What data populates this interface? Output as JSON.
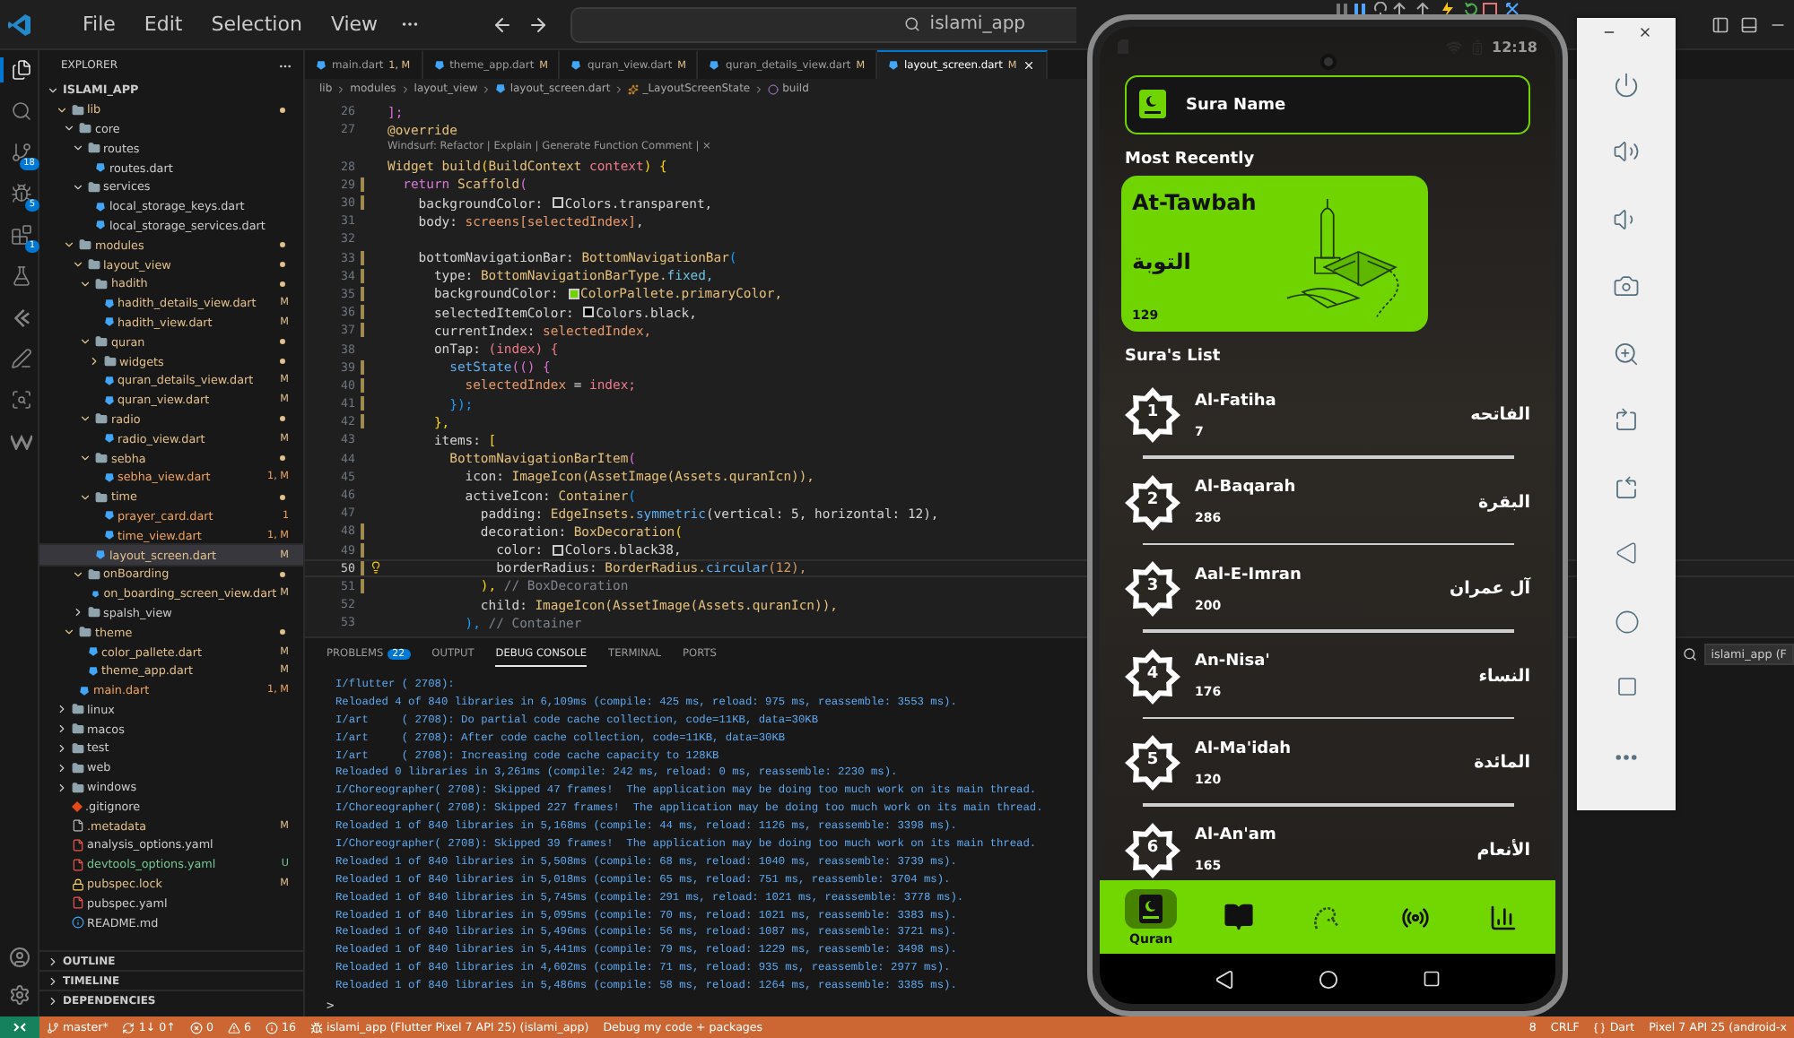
{
  "title_bar": {
    "menu": [
      "File",
      "Edit",
      "Selection",
      "View"
    ],
    "search": {
      "label": "islami_app"
    }
  },
  "activity_bar": [
    {
      "kind": "explorer",
      "selected": true
    },
    {
      "kind": "search",
      "selected": false
    },
    {
      "kind": "source-control",
      "badge": "18",
      "selected": false
    },
    {
      "kind": "debug",
      "badge": "5",
      "selected": false
    },
    {
      "kind": "extensions",
      "badge": "1",
      "selected": false
    },
    {
      "kind": "testing",
      "selected": false
    },
    {
      "kind": "flutter",
      "selected": false
    },
    {
      "kind": "pen",
      "selected": false
    },
    {
      "kind": "scan",
      "selected": false
    },
    {
      "kind": "windsurf",
      "selected": false
    }
  ],
  "explorer": {
    "title": "EXPLORER",
    "workspace": {
      "name": "ISLAMI_APP",
      "expanded": true
    },
    "tree": [
      {
        "name": "lib",
        "kind": "folder",
        "color": "#e2c08d",
        "changed": true,
        "expanded": true,
        "selected": false,
        "children": [
          {
            "name": "core",
            "kind": "folder",
            "color": "#cccccc",
            "changed": false,
            "expanded": true,
            "selected": false,
            "children": [
              {
                "name": "routes",
                "kind": "folder",
                "color": "#cccccc",
                "changed": false,
                "expanded": true,
                "selected": false,
                "children": [
                  {
                    "name": "routes.dart",
                    "kind": "dart",
                    "color": "#cccccc",
                    "selected": false
                  }
                ]
              },
              {
                "name": "services",
                "kind": "folder",
                "color": "#cccccc",
                "changed": false,
                "expanded": true,
                "selected": false,
                "children": [
                  {
                    "name": "local_storage_keys.dart",
                    "kind": "dart",
                    "color": "#cccccc",
                    "selected": false
                  },
                  {
                    "name": "local_storage_services.dart",
                    "kind": "dart",
                    "color": "#cccccc",
                    "selected": false
                  }
                ]
              }
            ]
          },
          {
            "name": "modules",
            "kind": "folder",
            "color": "#e2c08d",
            "changed": true,
            "expanded": true,
            "selected": false,
            "children": [
              {
                "name": "layout_view",
                "kind": "folder",
                "color": "#e2c08d",
                "changed": true,
                "expanded": true,
                "selected": false,
                "children": [
                  {
                    "name": "hadith",
                    "kind": "folder",
                    "color": "#e2c08d",
                    "changed": true,
                    "expanded": true,
                    "selected": false,
                    "children": [
                      {
                        "name": "hadith_details_view.dart",
                        "kind": "dart",
                        "color": "#e2c08d",
                        "badge": "M",
                        "selected": false
                      },
                      {
                        "name": "hadith_view.dart",
                        "kind": "dart",
                        "color": "#e2c08d",
                        "badge": "M",
                        "selected": false
                      }
                    ]
                  },
                  {
                    "name": "quran",
                    "kind": "folder",
                    "color": "#e2c08d",
                    "changed": true,
                    "expanded": true,
                    "selected": false,
                    "children": [
                      {
                        "name": "widgets",
                        "kind": "folder",
                        "color": "#e2c08d",
                        "changed": true,
                        "expanded": false,
                        "selected": false
                      },
                      {
                        "name": "quran_details_view.dart",
                        "kind": "dart",
                        "color": "#e2c08d",
                        "badge": "M",
                        "selected": false
                      },
                      {
                        "name": "quran_view.dart",
                        "kind": "dart",
                        "color": "#e2c08d",
                        "badge": "M",
                        "selected": false
                      }
                    ]
                  },
                  {
                    "name": "radio",
                    "kind": "folder",
                    "color": "#e2c08d",
                    "changed": true,
                    "expanded": true,
                    "selected": false,
                    "children": [
                      {
                        "name": "radio_view.dart",
                        "kind": "dart",
                        "color": "#e2c08d",
                        "badge": "M",
                        "selected": false
                      }
                    ]
                  },
                  {
                    "name": "sebha",
                    "kind": "folder",
                    "color": "#e2c08d",
                    "changed": true,
                    "expanded": true,
                    "selected": false,
                    "children": [
                      {
                        "name": "sebha_view.dart",
                        "kind": "dart",
                        "color": "#f0a35e",
                        "badge": "1, M",
                        "selected": false
                      }
                    ]
                  },
                  {
                    "name": "time",
                    "kind": "folder",
                    "color": "#e2c08d",
                    "changed": true,
                    "expanded": true,
                    "selected": false,
                    "children": [
                      {
                        "name": "prayer_card.dart",
                        "kind": "dart",
                        "color": "#f0a35e",
                        "badge": "1",
                        "selected": false
                      },
                      {
                        "name": "time_view.dart",
                        "kind": "dart",
                        "color": "#f0a35e",
                        "badge": "1, M",
                        "selected": false
                      }
                    ]
                  },
                  {
                    "name": "layout_screen.dart",
                    "kind": "dart",
                    "color": "#e2c08d",
                    "badge": "M",
                    "selected": true
                  }
                ]
              },
              {
                "name": "onBoarding",
                "kind": "folder",
                "color": "#e2c08d",
                "changed": true,
                "expanded": true,
                "selected": false,
                "children": [
                  {
                    "name": "on_boarding_screen_view.dart",
                    "kind": "dart",
                    "color": "#e2c08d",
                    "badge": "M",
                    "selected": false
                  }
                ]
              },
              {
                "name": "spalsh_view",
                "kind": "folder",
                "color": "#cccccc",
                "changed": false,
                "expanded": false,
                "selected": false
              }
            ]
          },
          {
            "name": "theme",
            "kind": "folder",
            "color": "#e2c08d",
            "changed": true,
            "expanded": true,
            "selected": false,
            "children": [
              {
                "name": "color_pallete.dart",
                "kind": "dart",
                "color": "#e2c08d",
                "badge": "M",
                "selected": false
              },
              {
                "name": "theme_app.dart",
                "kind": "dart",
                "color": "#e2c08d",
                "badge": "M",
                "selected": false
              }
            ]
          },
          {
            "name": "main.dart",
            "kind": "dart",
            "color": "#f0a35e",
            "badge": "1, M",
            "selected": false
          }
        ]
      },
      {
        "name": "linux",
        "kind": "folder",
        "color": "#cccccc",
        "changed": false,
        "expanded": false,
        "selected": false
      },
      {
        "name": "macos",
        "kind": "folder",
        "color": "#cccccc",
        "changed": false,
        "expanded": false,
        "selected": false
      },
      {
        "name": "test",
        "kind": "folder",
        "color": "#cccccc",
        "changed": false,
        "expanded": false,
        "selected": false
      },
      {
        "name": "web",
        "kind": "folder",
        "color": "#cccccc",
        "changed": false,
        "expanded": false,
        "selected": false
      },
      {
        "name": "windows",
        "kind": "folder",
        "color": "#cccccc",
        "changed": false,
        "expanded": false,
        "selected": false
      },
      {
        "name": ".gitignore",
        "kind": "git",
        "color": "#cccccc",
        "selected": false
      },
      {
        "name": ".metadata",
        "kind": "file",
        "color": "#e2c08d",
        "badge": "M",
        "selected": false
      },
      {
        "name": "analysis_options.yaml",
        "kind": "yaml",
        "color": "#cccccc",
        "selected": false
      },
      {
        "name": "devtools_options.yaml",
        "kind": "yaml",
        "color": "#73c991",
        "badge": "U",
        "selected": false
      },
      {
        "name": "pubspec.lock",
        "kind": "lock",
        "color": "#e2c08d",
        "badge": "M",
        "selected": false
      },
      {
        "name": "pubspec.yaml",
        "kind": "yaml",
        "color": "#cccccc",
        "selected": false
      },
      {
        "name": "README.md",
        "kind": "info",
        "color": "#cccccc",
        "selected": false
      }
    ],
    "sections": [
      {
        "label": "OUTLINE",
        "expanded": false
      },
      {
        "label": "TIMELINE",
        "expanded": false
      },
      {
        "label": "DEPENDENCIES",
        "expanded": false
      }
    ]
  },
  "editor": {
    "tabs": [
      {
        "label": "main.dart",
        "badge": "1, M",
        "selected": false
      },
      {
        "label": "theme_app.dart",
        "badge": "M",
        "selected": false
      },
      {
        "label": "quran_view.dart",
        "badge": "M",
        "selected": false
      },
      {
        "label": "quran_details_view.dart",
        "badge": "M",
        "selected": false
      },
      {
        "label": "layout_screen.dart",
        "badge": "M",
        "selected": true
      }
    ],
    "breadcrumb": [
      {
        "kind": "folder",
        "text": "lib"
      },
      {
        "kind": "folder",
        "text": "modules"
      },
      {
        "kind": "folder",
        "text": "layout_view"
      },
      {
        "kind": "dart",
        "text": "layout_screen.dart"
      },
      {
        "kind": "class",
        "text": "_LayoutScreenState"
      },
      {
        "kind": "method",
        "text": "build"
      }
    ],
    "lines": [
      {
        "kind": "code",
        "number": "26",
        "changed": false,
        "current": false,
        "tokens": [
          {
            "kind": "br2",
            "text": "];"
          }
        ]
      },
      {
        "kind": "code",
        "number": "27",
        "changed": false,
        "current": false,
        "tokens": [
          {
            "kind": "type",
            "text": "@override"
          }
        ]
      },
      {
        "kind": "lens",
        "text": "Windsurf: Refactor | Explain | Generate Function Comment | ×"
      },
      {
        "kind": "code",
        "number": "28",
        "changed": false,
        "current": false,
        "tokens": [
          {
            "kind": "type",
            "text": "Widget build"
          },
          {
            "kind": "br1",
            "text": "("
          },
          {
            "kind": "type",
            "text": "BuildContext "
          },
          {
            "kind": "param",
            "text": "context"
          },
          {
            "kind": "br1",
            "text": ") {"
          }
        ]
      },
      {
        "kind": "code",
        "number": "29",
        "changed": true,
        "current": false,
        "tokens": [
          {
            "kind": "kw",
            "text": "  return "
          },
          {
            "kind": "type",
            "text": "Scaffold"
          },
          {
            "kind": "br2",
            "text": "("
          }
        ]
      },
      {
        "kind": "code",
        "number": "30",
        "changed": true,
        "current": false,
        "tokens": [
          {
            "kind": "plain",
            "text": "    backgroundColor: "
          },
          {
            "kind": "swatch",
            "color": "#1f1f1f"
          },
          {
            "kind": "plain",
            "text": "Colors.transparent,"
          }
        ]
      },
      {
        "kind": "code",
        "number": "31",
        "changed": false,
        "current": false,
        "tokens": [
          {
            "kind": "plain",
            "text": "    body: "
          },
          {
            "kind": "var",
            "text": "screens[selectedIndex]"
          },
          {
            "kind": "plain",
            "text": ","
          }
        ]
      },
      {
        "kind": "code",
        "number": "32",
        "changed": false,
        "current": false
      },
      {
        "kind": "code",
        "number": "33",
        "changed": true,
        "current": false,
        "tokens": [
          {
            "kind": "plain",
            "text": "    bottomNavigationBar: "
          },
          {
            "kind": "type",
            "text": "BottomNavigationBar"
          },
          {
            "kind": "br3",
            "text": "("
          }
        ]
      },
      {
        "kind": "code",
        "number": "34",
        "changed": true,
        "current": false,
        "tokens": [
          {
            "kind": "plain",
            "text": "      type: "
          },
          {
            "kind": "type",
            "text": "BottomNavigationBarType."
          },
          {
            "kind": "member",
            "text": "fixed,"
          }
        ]
      },
      {
        "kind": "code",
        "number": "35",
        "changed": true,
        "current": false,
        "tokens": [
          {
            "kind": "plain",
            "text": "      backgroundColor: "
          },
          {
            "kind": "swatch",
            "color": "#6fd400"
          },
          {
            "kind": "type",
            "text": "ColorPallete.primaryColor,"
          }
        ]
      },
      {
        "kind": "code",
        "number": "36",
        "changed": true,
        "current": false,
        "tokens": [
          {
            "kind": "plain",
            "text": "      selectedItemColor: "
          },
          {
            "kind": "swatch",
            "color": "#000000"
          },
          {
            "kind": "plain",
            "text": "Colors.black,"
          }
        ]
      },
      {
        "kind": "code",
        "number": "37",
        "changed": true,
        "current": false,
        "tokens": [
          {
            "kind": "plain",
            "text": "      currentIndex: "
          },
          {
            "kind": "var",
            "text": "selectedIndex,"
          }
        ]
      },
      {
        "kind": "code",
        "number": "38",
        "changed": false,
        "current": false,
        "tokens": [
          {
            "kind": "plain",
            "text": "      onTap: "
          },
          {
            "kind": "param",
            "text": "(index) {"
          }
        ]
      },
      {
        "kind": "code",
        "number": "39",
        "changed": true,
        "current": false,
        "tokens": [
          {
            "kind": "fn",
            "text": "        setState"
          },
          {
            "kind": "br2",
            "text": "(() {"
          }
        ]
      },
      {
        "kind": "code",
        "number": "40",
        "changed": true,
        "current": false,
        "tokens": [
          {
            "kind": "var",
            "text": "          selectedIndex"
          },
          {
            "kind": "plain",
            "text": " = "
          },
          {
            "kind": "param",
            "text": "index;"
          }
        ]
      },
      {
        "kind": "code",
        "number": "41",
        "changed": true,
        "current": false,
        "tokens": [
          {
            "kind": "br3",
            "text": "        });"
          }
        ]
      },
      {
        "kind": "code",
        "number": "42",
        "changed": true,
        "current": false,
        "tokens": [
          {
            "kind": "br1",
            "text": "      },"
          }
        ]
      },
      {
        "kind": "code",
        "number": "43",
        "changed": false,
        "current": false,
        "tokens": [
          {
            "kind": "plain",
            "text": "      items: "
          },
          {
            "kind": "br1",
            "text": "["
          }
        ]
      },
      {
        "kind": "code",
        "number": "44",
        "changed": false,
        "current": false,
        "tokens": [
          {
            "kind": "type",
            "text": "        BottomNavigationBarItem"
          },
          {
            "kind": "br2",
            "text": "("
          }
        ]
      },
      {
        "kind": "code",
        "number": "45",
        "changed": false,
        "current": false,
        "tokens": [
          {
            "kind": "plain",
            "text": "          icon: "
          },
          {
            "kind": "type",
            "text": "ImageIcon(AssetImage(Assets.quranIcn)),"
          }
        ]
      },
      {
        "kind": "code",
        "number": "46",
        "changed": false,
        "current": false,
        "tokens": [
          {
            "kind": "plain",
            "text": "          activeIcon: "
          },
          {
            "kind": "type",
            "text": "Container"
          },
          {
            "kind": "br3",
            "text": "("
          }
        ]
      },
      {
        "kind": "code",
        "number": "47",
        "changed": false,
        "current": false,
        "tokens": [
          {
            "kind": "plain",
            "text": "            padding: "
          },
          {
            "kind": "type",
            "text": "EdgeInsets."
          },
          {
            "kind": "fn",
            "text": "symmetric"
          },
          {
            "kind": "plain",
            "text": "(vertical: 5, horizontal: 12),"
          }
        ]
      },
      {
        "kind": "code",
        "number": "48",
        "changed": true,
        "current": false,
        "tokens": [
          {
            "kind": "plain",
            "text": "            decoration: "
          },
          {
            "kind": "type",
            "text": "BoxDecoration"
          },
          {
            "kind": "br1",
            "text": "("
          }
        ]
      },
      {
        "kind": "code",
        "number": "49",
        "changed": true,
        "current": false,
        "tokens": [
          {
            "kind": "plain",
            "text": "              color: "
          },
          {
            "kind": "swatch",
            "color": "#1f1f1f"
          },
          {
            "kind": "plain",
            "text": "Colors.black38,"
          }
        ]
      },
      {
        "kind": "code",
        "number": "50",
        "changed": true,
        "current": true,
        "tokens": [
          {
            "kind": "plain",
            "text": "              borderRadius: "
          },
          {
            "kind": "type",
            "text": "BorderRadius."
          },
          {
            "kind": "fn",
            "text": "circular"
          },
          {
            "kind": "num",
            "text": "(12),"
          }
        ]
      },
      {
        "kind": "code",
        "number": "51",
        "changed": true,
        "current": false,
        "tokens": [
          {
            "kind": "br1",
            "text": "            ),"
          },
          {
            "kind": "cmt",
            "text": " // BoxDecoration"
          }
        ]
      },
      {
        "kind": "code",
        "number": "52",
        "changed": false,
        "current": false,
        "tokens": [
          {
            "kind": "plain",
            "text": "            child: "
          },
          {
            "kind": "type",
            "text": "ImageIcon(AssetImage(Assets.quranIcn)),"
          }
        ]
      },
      {
        "kind": "code",
        "number": "53",
        "changed": false,
        "current": false,
        "tokens": [
          {
            "kind": "br3",
            "text": "          ),"
          },
          {
            "kind": "cmt",
            "text": " // Container"
          }
        ]
      }
    ]
  },
  "panel": {
    "tabs": [
      {
        "label": "PROBLEMS",
        "badge": "22",
        "selected": false
      },
      {
        "label": "OUTPUT",
        "selected": false
      },
      {
        "label": "DEBUG CONSOLE",
        "selected": true
      },
      {
        "label": "TERMINAL",
        "selected": false
      },
      {
        "label": "PORTS",
        "selected": false
      }
    ],
    "session_select": {
      "value": "islami_app (F"
    },
    "console": [
      "I/flutter ( 2708):",
      "Reloaded 4 of 840 libraries in 6,109ms (compile: 425 ms, reload: 975 ms, reassemble: 3553 ms).",
      "I/art     ( 2708): Do partial code cache collection, code=11KB, data=30KB",
      "I/art     ( 2708): After code cache collection, code=11KB, data=30KB",
      "I/art     ( 2708): Increasing code cache capacity to 128KB",
      "Reloaded 0 libraries in 3,261ms (compile: 242 ms, reload: 0 ms, reassemble: 2230 ms).",
      "I/Choreographer( 2708): Skipped 47 frames!  The application may be doing too much work on its main thread.",
      "I/Choreographer( 2708): Skipped 227 frames!  The application may be doing too much work on its main thread.",
      "Reloaded 1 of 840 libraries in 5,168ms (compile: 44 ms, reload: 1126 ms, reassemble: 3398 ms).",
      "I/Choreographer( 2708): Skipped 39 frames!  The application may be doing too much work on its main thread.",
      "Reloaded 1 of 840 libraries in 5,508ms (compile: 68 ms, reload: 1040 ms, reassemble: 3739 ms).",
      "Reloaded 1 of 840 libraries in 5,018ms (compile: 65 ms, reload: 751 ms, reassemble: 3704 ms).",
      "Reloaded 1 of 840 libraries in 5,745ms (compile: 291 ms, reload: 1021 ms, reassemble: 3778 ms).",
      "Reloaded 1 of 840 libraries in 5,095ms (compile: 70 ms, reload: 1021 ms, reassemble: 3383 ms).",
      "Reloaded 1 of 840 libraries in 5,496ms (compile: 56 ms, reload: 1087 ms, reassemble: 3721 ms).",
      "Reloaded 1 of 840 libraries in 5,441ms (compile: 79 ms, reload: 1229 ms, reassemble: 3498 ms).",
      "Reloaded 1 of 840 libraries in 4,602ms (compile: 71 ms, reload: 935 ms, reassemble: 2977 ms).",
      "Reloaded 1 of 840 libraries in 5,486ms (compile: 58 ms, reload: 1264 ms, reassemble: 3385 ms)."
    ],
    "prompt": ">"
  },
  "status_bar": {
    "left": [
      {
        "kind": "branch",
        "text": "master*"
      },
      {
        "kind": "sync",
        "text": "1↓ 0↑"
      },
      {
        "kind": "errors",
        "text": "0"
      },
      {
        "kind": "warnings",
        "text": "6"
      },
      {
        "kind": "info",
        "text": "16"
      },
      {
        "kind": "debug",
        "text": "islami_app (Flutter Pixel 7 API 25) (islami_app)"
      },
      {
        "kind": "plain",
        "text": "Debug my code + packages"
      }
    ],
    "right": [
      {
        "kind": "plain",
        "text": "8"
      },
      {
        "kind": "plain",
        "text": "CRLF"
      },
      {
        "kind": "language",
        "text": "Dart"
      },
      {
        "kind": "plain",
        "text": "Pixel 7 API 25 (android-x"
      }
    ]
  },
  "phone": {
    "time": "12:18",
    "search": {
      "placeholder": "Sura Name"
    },
    "recent_title": "Most Recently",
    "recent": {
      "name": "At-Tawbah",
      "arabic": "التوبة",
      "verses": "129"
    },
    "list_title": "Sura's List",
    "suras": [
      {
        "number": "1",
        "name": "Al-Fatiha",
        "verses": "7",
        "arabic": "الفاتحه"
      },
      {
        "number": "2",
        "name": "Al-Baqarah",
        "verses": "286",
        "arabic": "البقرة"
      },
      {
        "number": "3",
        "name": "Aal-E-Imran",
        "verses": "200",
        "arabic": "آل عمران"
      },
      {
        "number": "4",
        "name": "An-Nisa'",
        "verses": "176",
        "arabic": "النساء"
      },
      {
        "number": "5",
        "name": "Al-Ma'idah",
        "verses": "120",
        "arabic": "المائدة"
      },
      {
        "number": "6",
        "name": "Al-An'am",
        "verses": "165",
        "arabic": "الأنعام"
      }
    ],
    "nav": [
      {
        "kind": "quran",
        "label": "Quran",
        "selected": true
      },
      {
        "kind": "book",
        "selected": false
      },
      {
        "kind": "sebha",
        "selected": false
      },
      {
        "kind": "radio",
        "selected": false
      },
      {
        "kind": "time",
        "selected": false
      }
    ]
  }
}
